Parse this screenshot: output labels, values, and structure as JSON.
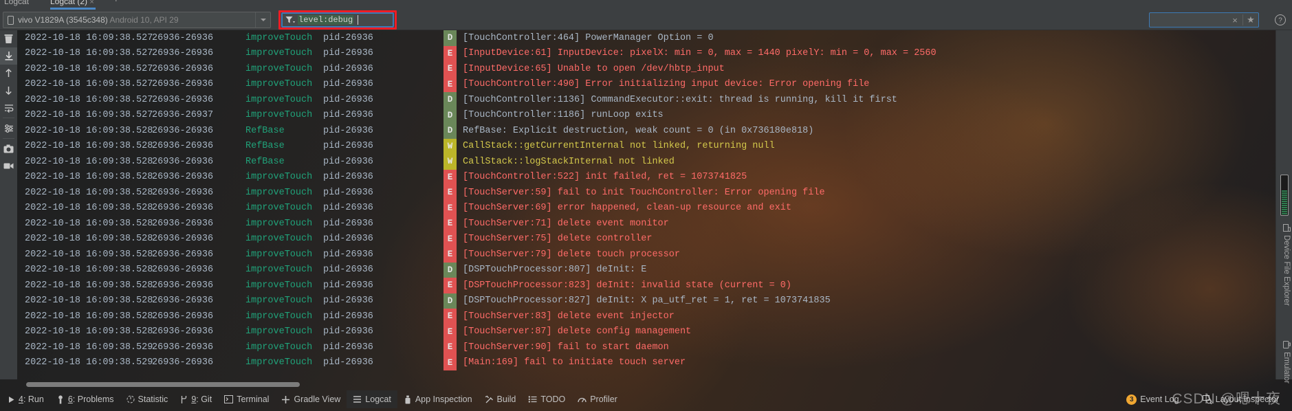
{
  "tabs": {
    "items": [
      {
        "label": "Logcat",
        "selected": false
      },
      {
        "label": "Logcat (2)",
        "selected": true
      }
    ],
    "close_glyph": "×",
    "add_glyph": "+"
  },
  "toolbar": {
    "device": {
      "name": "vivo V1829A (3545c348)",
      "details": "Android 10, API 29",
      "icon": "phone-icon"
    },
    "filter": {
      "value": "level:debug",
      "icon": "filter-icon",
      "highlight_color": "#ee1c24"
    },
    "search": {
      "value": "",
      "clear_glyph": "×",
      "star_glyph": "★"
    },
    "help_glyph": "?"
  },
  "gutter": {
    "items": [
      {
        "name": "clear-logcat-icon",
        "active": false
      },
      {
        "name": "scroll-to-end-icon",
        "active": true
      },
      {
        "name": "up-arrow-icon",
        "active": false
      },
      {
        "name": "down-arrow-icon",
        "active": false
      },
      {
        "name": "soft-wrap-icon",
        "active": false
      },
      {
        "name": "filter-settings-icon",
        "active": false
      },
      {
        "name": "screenshot-icon",
        "active": false
      },
      {
        "name": "screen-record-icon",
        "active": false
      }
    ]
  },
  "log": {
    "columns": [
      "date-time",
      "pid-tid",
      "tag",
      "package",
      "level",
      "message"
    ],
    "rows": [
      {
        "time": "2022-10-18 16:09:38.527",
        "pids": "26936-26936",
        "tag": "improveTouch",
        "pkg": "pid-26936",
        "level": "D",
        "message": "[TouchController:464] PowerManager Option = 0"
      },
      {
        "time": "2022-10-18 16:09:38.527",
        "pids": "26936-26936",
        "tag": "improveTouch",
        "pkg": "pid-26936",
        "level": "E",
        "message": "[InputDevice:61] InputDevice: pixelX: min = 0, max = 1440 pixelY: min = 0, max = 2560"
      },
      {
        "time": "2022-10-18 16:09:38.527",
        "pids": "26936-26936",
        "tag": "improveTouch",
        "pkg": "pid-26936",
        "level": "E",
        "message": "[InputDevice:65] Unable to open /dev/hbtp_input"
      },
      {
        "time": "2022-10-18 16:09:38.527",
        "pids": "26936-26936",
        "tag": "improveTouch",
        "pkg": "pid-26936",
        "level": "E",
        "message": "[TouchController:490] Error initializing input device: Error opening file"
      },
      {
        "time": "2022-10-18 16:09:38.527",
        "pids": "26936-26936",
        "tag": "improveTouch",
        "pkg": "pid-26936",
        "level": "D",
        "message": "[TouchController:1136] CommandExecutor::exit: thread is running, kill it first"
      },
      {
        "time": "2022-10-18 16:09:38.527",
        "pids": "26936-26937",
        "tag": "improveTouch",
        "pkg": "pid-26936",
        "level": "D",
        "message": "[TouchController:1186] runLoop exits"
      },
      {
        "time": "2022-10-18 16:09:38.528",
        "pids": "26936-26936",
        "tag": "RefBase",
        "pkg": "pid-26936",
        "level": "D",
        "message": "RefBase: Explicit destruction, weak count = 0 (in 0x736180e818)"
      },
      {
        "time": "2022-10-18 16:09:38.528",
        "pids": "26936-26936",
        "tag": "RefBase",
        "pkg": "pid-26936",
        "level": "W",
        "message": "CallStack::getCurrentInternal not linked, returning null"
      },
      {
        "time": "2022-10-18 16:09:38.528",
        "pids": "26936-26936",
        "tag": "RefBase",
        "pkg": "pid-26936",
        "level": "W",
        "message": "CallStack::logStackInternal not linked"
      },
      {
        "time": "2022-10-18 16:09:38.528",
        "pids": "26936-26936",
        "tag": "improveTouch",
        "pkg": "pid-26936",
        "level": "E",
        "message": "[TouchController:522] init failed, ret = 1073741825"
      },
      {
        "time": "2022-10-18 16:09:38.528",
        "pids": "26936-26936",
        "tag": "improveTouch",
        "pkg": "pid-26936",
        "level": "E",
        "message": "[TouchServer:59] fail to init TouchController: Error opening file"
      },
      {
        "time": "2022-10-18 16:09:38.528",
        "pids": "26936-26936",
        "tag": "improveTouch",
        "pkg": "pid-26936",
        "level": "E",
        "message": "[TouchServer:69] error happened, clean-up resource and exit"
      },
      {
        "time": "2022-10-18 16:09:38.528",
        "pids": "26936-26936",
        "tag": "improveTouch",
        "pkg": "pid-26936",
        "level": "E",
        "message": "[TouchServer:71] delete event monitor"
      },
      {
        "time": "2022-10-18 16:09:38.528",
        "pids": "26936-26936",
        "tag": "improveTouch",
        "pkg": "pid-26936",
        "level": "E",
        "message": "[TouchServer:75] delete controller"
      },
      {
        "time": "2022-10-18 16:09:38.528",
        "pids": "26936-26936",
        "tag": "improveTouch",
        "pkg": "pid-26936",
        "level": "E",
        "message": "[TouchServer:79] delete touch processor"
      },
      {
        "time": "2022-10-18 16:09:38.528",
        "pids": "26936-26936",
        "tag": "improveTouch",
        "pkg": "pid-26936",
        "level": "D",
        "message": "[DSPTouchProcessor:807] deInit: E"
      },
      {
        "time": "2022-10-18 16:09:38.528",
        "pids": "26936-26936",
        "tag": "improveTouch",
        "pkg": "pid-26936",
        "level": "E",
        "message": "[DSPTouchProcessor:823] deInit: invalid state (current = 0)"
      },
      {
        "time": "2022-10-18 16:09:38.528",
        "pids": "26936-26936",
        "tag": "improveTouch",
        "pkg": "pid-26936",
        "level": "D",
        "message": "[DSPTouchProcessor:827] deInit: X pa_utf_ret = 1, ret = 1073741835"
      },
      {
        "time": "2022-10-18 16:09:38.528",
        "pids": "26936-26936",
        "tag": "improveTouch",
        "pkg": "pid-26936",
        "level": "E",
        "message": "[TouchServer:83] delete event injector"
      },
      {
        "time": "2022-10-18 16:09:38.528",
        "pids": "26936-26936",
        "tag": "improveTouch",
        "pkg": "pid-26936",
        "level": "E",
        "message": "[TouchServer:87] delete config management"
      },
      {
        "time": "2022-10-18 16:09:38.529",
        "pids": "26936-26936",
        "tag": "improveTouch",
        "pkg": "pid-26936",
        "level": "E",
        "message": "[TouchServer:90] fail to start daemon"
      },
      {
        "time": "2022-10-18 16:09:38.529",
        "pids": "26936-26936",
        "tag": "improveTouch",
        "pkg": "pid-26936",
        "level": "E",
        "message": "[Main:169] fail to initiate touch server"
      }
    ]
  },
  "right_strip": {
    "items": [
      {
        "label": "Device File Explorer",
        "icon": "device-file-explorer-icon"
      },
      {
        "label": "Emulator",
        "icon": "emulator-icon"
      }
    ]
  },
  "statusbar": {
    "left_items": [
      {
        "mnemonic": "4",
        "label": "Run",
        "icon": "run-icon",
        "active": false
      },
      {
        "mnemonic": "6",
        "label": "Problems",
        "icon": "problems-icon",
        "active": false
      },
      {
        "mnemonic": "",
        "label": "Statistic",
        "icon": "statistic-icon",
        "active": false
      },
      {
        "mnemonic": "9",
        "label": "Git",
        "icon": "git-icon",
        "active": false
      },
      {
        "mnemonic": "",
        "label": "Terminal",
        "icon": "terminal-icon",
        "active": false
      },
      {
        "mnemonic": "",
        "label": "Gradle View",
        "icon": "gradle-view-icon",
        "active": false
      },
      {
        "mnemonic": "",
        "label": "Logcat",
        "icon": "logcat-icon",
        "active": true
      },
      {
        "mnemonic": "",
        "label": "App Inspection",
        "icon": "app-inspection-icon",
        "active": false
      },
      {
        "mnemonic": "",
        "label": "Build",
        "icon": "build-icon",
        "active": false
      },
      {
        "mnemonic": "",
        "label": "TODO",
        "icon": "todo-icon",
        "active": false
      },
      {
        "mnemonic": "",
        "label": "Profiler",
        "icon": "profiler-icon",
        "active": false
      }
    ],
    "right_items": [
      {
        "label": "Event Log",
        "icon": "event-log-icon",
        "badge": "3"
      },
      {
        "label": "Layout Inspector",
        "icon": "layout-inspector-icon",
        "badge": ""
      }
    ]
  },
  "watermark": {
    "text": "CSDN @嗯十夜"
  }
}
